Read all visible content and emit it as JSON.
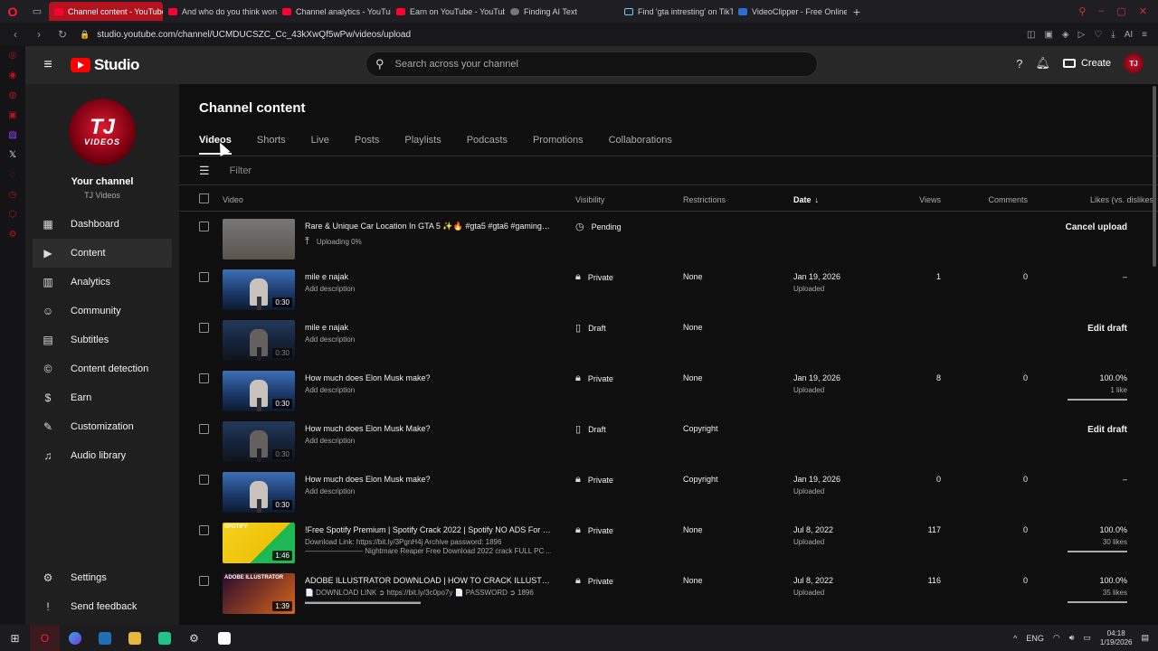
{
  "browser": {
    "tabs": [
      {
        "label": "Channel content - YouTube",
        "active": true,
        "fav": "youtube"
      },
      {
        "label": "And who do you think won",
        "active": false,
        "fav": "youtube"
      },
      {
        "label": "Channel analytics - YouTube",
        "active": false,
        "fav": "youtube"
      },
      {
        "label": "Earn on YouTube - YouTube",
        "active": false,
        "fav": "youtube"
      },
      {
        "label": "Finding AI Text",
        "active": false,
        "fav": "grey"
      },
      {
        "label": "Find 'gta intresting' on TikTok",
        "active": false,
        "fav": "tiktok"
      },
      {
        "label": "VideoClipper - Free Online",
        "active": false,
        "fav": "blue"
      }
    ],
    "url": "studio.youtube.com/channel/UCMDUCSZC_Cc_43kXwQf5wPw/videos/upload",
    "addr_ai_label": "AI"
  },
  "header": {
    "logo_text": "Studio",
    "search_placeholder": "Search across your channel",
    "create_label": "Create",
    "avatar_text": "TJ"
  },
  "sidebar": {
    "avatar_line1": "TJ",
    "avatar_line2": "VIDEOS",
    "your_channel": "Your channel",
    "channel_name": "TJ Videos",
    "items": [
      {
        "label": "Dashboard",
        "icon": "dashboard-icon",
        "glyph": "▦"
      },
      {
        "label": "Content",
        "icon": "content-icon",
        "glyph": "▶",
        "active": true
      },
      {
        "label": "Analytics",
        "icon": "analytics-icon",
        "glyph": "▥"
      },
      {
        "label": "Community",
        "icon": "community-icon",
        "glyph": "☺"
      },
      {
        "label": "Subtitles",
        "icon": "subtitles-icon",
        "glyph": "▤"
      },
      {
        "label": "Content detection",
        "icon": "content-detection-icon",
        "glyph": "©"
      },
      {
        "label": "Earn",
        "icon": "earn-icon",
        "glyph": "$"
      },
      {
        "label": "Customization",
        "icon": "customization-icon",
        "glyph": "✎"
      },
      {
        "label": "Audio library",
        "icon": "audio-library-icon",
        "glyph": "♫"
      }
    ],
    "bottom": [
      {
        "label": "Settings",
        "icon": "settings-icon",
        "glyph": "⚙"
      },
      {
        "label": "Send feedback",
        "icon": "feedback-icon",
        "glyph": "!"
      }
    ]
  },
  "main": {
    "title": "Channel content",
    "tabs": [
      "Videos",
      "Shorts",
      "Live",
      "Posts",
      "Playlists",
      "Podcasts",
      "Promotions",
      "Collaborations"
    ],
    "filter_label": "Filter",
    "columns": {
      "video": "Video",
      "visibility": "Visibility",
      "restrictions": "Restrictions",
      "date": "Date",
      "views": "Views",
      "comments": "Comments",
      "likes": "Likes (vs. dislikes)"
    }
  },
  "rows": [
    {
      "type": "pending",
      "title": "Rare & Unique Car Location In GTA 5 ✨🔥 #gta5 #gta6 #gaming #unit...",
      "upload_status": "Uploading 0%",
      "visibility": "Pending",
      "vis_icon": "clock-icon",
      "action": "Cancel upload"
    },
    {
      "type": "normal",
      "title": "mile e najak",
      "desc": "Add description",
      "duration": "0:30",
      "visibility": "Private",
      "vis_icon": "lock-icon",
      "restrictions": "None",
      "date": "Jan 19, 2026",
      "date_sub": "Uploaded",
      "views": "1",
      "comments": "0",
      "likes": "–"
    },
    {
      "type": "draft",
      "title": "mile e najak",
      "desc": "Add description",
      "duration": "0:30",
      "visibility": "Draft",
      "vis_icon": "draft-icon",
      "restrictions": "None",
      "action": "Edit draft"
    },
    {
      "type": "normal",
      "title": "How much does Elon Musk make?",
      "desc": "Add description",
      "duration": "0:30",
      "visibility": "Private",
      "vis_icon": "lock-icon",
      "restrictions": "None",
      "date": "Jan 19, 2026",
      "date_sub": "Uploaded",
      "views": "8",
      "comments": "0",
      "likes": "100.0%",
      "likes_sub": "1 like"
    },
    {
      "type": "draft",
      "title": "How much does Elon Musk Make?",
      "desc": "Add description",
      "duration": "0:30",
      "visibility": "Draft",
      "vis_icon": "draft-icon",
      "restrictions": "Copyright",
      "action": "Edit draft"
    },
    {
      "type": "normal",
      "title": "How much does Elon Musk make?",
      "desc": "Add description",
      "duration": "0:30",
      "visibility": "Private",
      "vis_icon": "lock-icon",
      "restrictions": "Copyright",
      "date": "Jan 19, 2026",
      "date_sub": "Uploaded",
      "views": "0",
      "comments": "0",
      "likes": "–"
    },
    {
      "type": "normal",
      "thumb": "spotify",
      "thumb_label": "SPOTIFY",
      "title": "!Free Spotify Premium | Spotify Crack 2022 | Spotify NO ADS For FREE |...",
      "desc": "Download Link: https://bit.ly/3PgnH4j Archive password: 1896",
      "desc2": "———————— Nightmare Reaper Free Download 2022 crack FULL PC ...",
      "duration": "1:46",
      "visibility": "Private",
      "vis_icon": "lock-icon",
      "restrictions": "None",
      "date": "Jul 8, 2022",
      "date_sub": "Uploaded",
      "views": "117",
      "comments": "0",
      "likes": "100.0%",
      "likes_sub": "30 likes"
    },
    {
      "type": "normal",
      "thumb": "adobe",
      "thumb_label": "ADOBE ILLUSTRATOR",
      "title": "ADOBE ILLUSTRATOR DOWNLOAD | HOW TO CRACK ILLUSTRATOR | ...",
      "desc": "📄 DOWNLOAD LINK ➲ https://bit.ly/3c0po7y 📄 PASSWORD ➲ 1896",
      "desc2": "▬▬▬▬▬▬▬▬▬▬▬▬▬▬▬▬",
      "duration": "1:39",
      "visibility": "Private",
      "vis_icon": "lock-icon",
      "restrictions": "None",
      "date": "Jul 8, 2022",
      "date_sub": "Uploaded",
      "views": "116",
      "comments": "0",
      "likes": "100.0%",
      "likes_sub": "35 likes"
    }
  ],
  "taskbar": {
    "lang": "ENG",
    "time": "04:18",
    "date": "1/19/2026"
  }
}
